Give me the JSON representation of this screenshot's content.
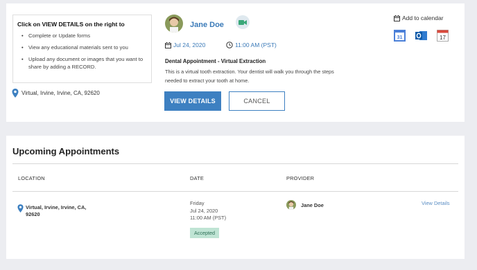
{
  "instructions": {
    "title_prefix": "Click on ",
    "title_highlight": "VIEW DETAILS",
    "title_suffix": " on the right to",
    "items": [
      "Complete or Update forms",
      "View any educational materials sent to you",
      "Upload any document or images that you want to share by adding a RECORD."
    ]
  },
  "appointment": {
    "location": "Virtual, Irvine, Irvine, CA, 92620",
    "provider": "Jane Doe",
    "date": "Jul 24, 2020",
    "time": "11:00 AM (PST)",
    "title": "Dental Appointment - Virtual Extraction",
    "description": "This is a virtual tooth extraction. Your dentist will walk you through the steps needed to extract your tooth at home.",
    "view_details_label": "VIEW DETAILS",
    "cancel_label": "CANCEL",
    "add_to_calendar": "Add to calendar",
    "calendar_icons": [
      "google-calendar-icon",
      "outlook-icon",
      "apple-calendar-icon"
    ],
    "google_day": "31",
    "apple_day": "17"
  },
  "upcoming": {
    "title": "Upcoming Appointments",
    "columns": [
      "LOCATION",
      "DATE",
      "PROVIDER"
    ],
    "rows": [
      {
        "location_line1": "Virtual, Irvine, Irvine, CA,",
        "location_line2": "92620",
        "day": "Friday",
        "date": "Jul 24, 2020",
        "time": "11:00 AM (PST)",
        "status": "Accepted",
        "provider": "Jane Doe",
        "action": "View Details"
      }
    ]
  },
  "colors": {
    "accent": "#3d80c1",
    "link": "#3a7ab8",
    "badge_bg": "#bfe4d4",
    "page_bg": "#ecedf1"
  }
}
